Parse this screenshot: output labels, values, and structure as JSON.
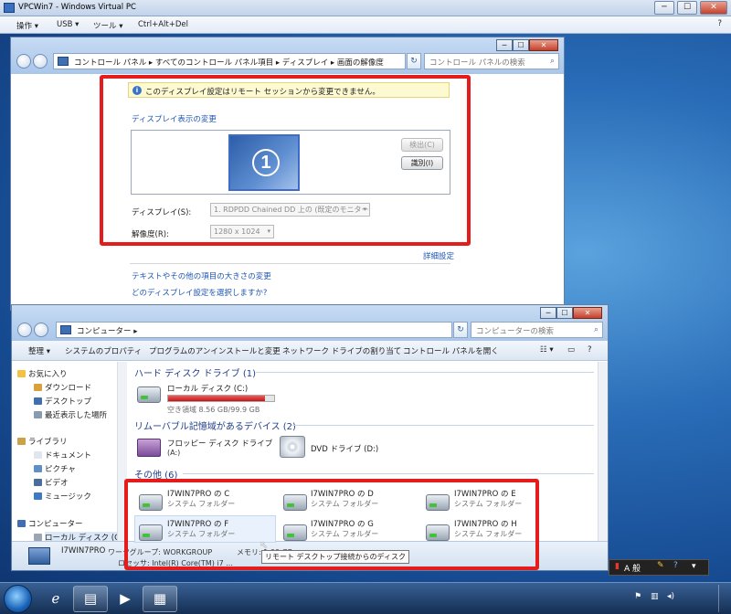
{
  "host": {
    "title": "VPCWin7 - Windows Virtual PC",
    "menu": [
      "操作 ▾",
      "USB ▾",
      "ツール ▾",
      "Ctrl+Alt+Del"
    ],
    "buttons": {
      "minimize": "─",
      "maximize": "☐",
      "close": "✕"
    },
    "help": "?"
  },
  "display_window": {
    "breadcrumb": "コントロール パネル  ▸  すべてのコントロール パネル項目  ▸  ディスプレイ  ▸  画面の解像度",
    "search_placeholder": "コントロール パネルの検索",
    "info_message": "このディスプレイ設定はリモート セッションから変更できません。",
    "section_title": "ディスプレイ表示の変更",
    "monitor_number": "1",
    "detect_button": "検出(C)",
    "identify_button": "識別(I)",
    "display_label": "ディスプレイ(S):",
    "display_value": "1. RDPDD Chained DD 上の (既定のモニター)",
    "resolution_label": "解像度(R):",
    "resolution_value": "1280 x 1024",
    "advanced_link": "詳細設定",
    "link_text_size": "テキストやその他の項目の大きさの変更",
    "link_which_settings": "どのディスプレイ設定を選択しますか?"
  },
  "computer_window": {
    "breadcrumb": "コンピューター  ▸",
    "search_placeholder": "コンピューターの検索",
    "toolbar": [
      "整理 ▾",
      "システムのプロパティ",
      "プログラムのアンインストールと変更",
      "ネットワーク ドライブの割り当て",
      "コントロール パネルを開く"
    ],
    "nav": {
      "favorites": "お気に入り",
      "downloads": "ダウンロード",
      "desktop": "デスクトップ",
      "recent": "最近表示した場所",
      "libraries": "ライブラリ",
      "documents": "ドキュメント",
      "pictures": "ピクチャ",
      "videos": "ビデオ",
      "music": "ミュージック",
      "computer": "コンピューター",
      "local_disk": "ローカル ディスク (C:)"
    },
    "groups": {
      "hdd": "ハード ディスク ドライブ (1)",
      "removable": "リムーバブル記憶域があるデバイス (2)",
      "other": "その他 (6)"
    },
    "local_disk": {
      "name": "ローカル ディスク (C:)",
      "free": "空き領域 8.56 GB/99.9 GB",
      "used_fraction": 0.914
    },
    "floppy": {
      "name": "フロッピー ディスク ドライブ",
      "sub": "(A:)"
    },
    "dvd": {
      "name": "DVD ドライブ (D:)"
    },
    "other_items": [
      {
        "name": "I7WIN7PRO の C",
        "sub": "システム フォルダー"
      },
      {
        "name": "I7WIN7PRO の D",
        "sub": "システム フォルダー"
      },
      {
        "name": "I7WIN7PRO の E",
        "sub": "システム フォルダー"
      },
      {
        "name": "I7WIN7PRO の F",
        "sub": "システム フォルダー"
      },
      {
        "name": "I7WIN7PRO の G",
        "sub": "システム フォルダー"
      },
      {
        "name": "I7WIN7PRO の H",
        "sub": "システム フォルダー"
      }
    ],
    "details": {
      "name": "I7WIN7PRO",
      "workgroup": "ワークグループ: WORKGROUP",
      "memory": "メモリ: 1.00 GB",
      "processor": "ロセッサ: Intel(R) Core(TM) i7 ..."
    },
    "tooltip": "リモート デスクトップ接続からのディスク"
  },
  "ime_bar": {
    "mode": "A 般"
  },
  "colors": {
    "highlight": "#e41c1c",
    "link": "#1f56b3",
    "accent": "#3d6bc8"
  }
}
